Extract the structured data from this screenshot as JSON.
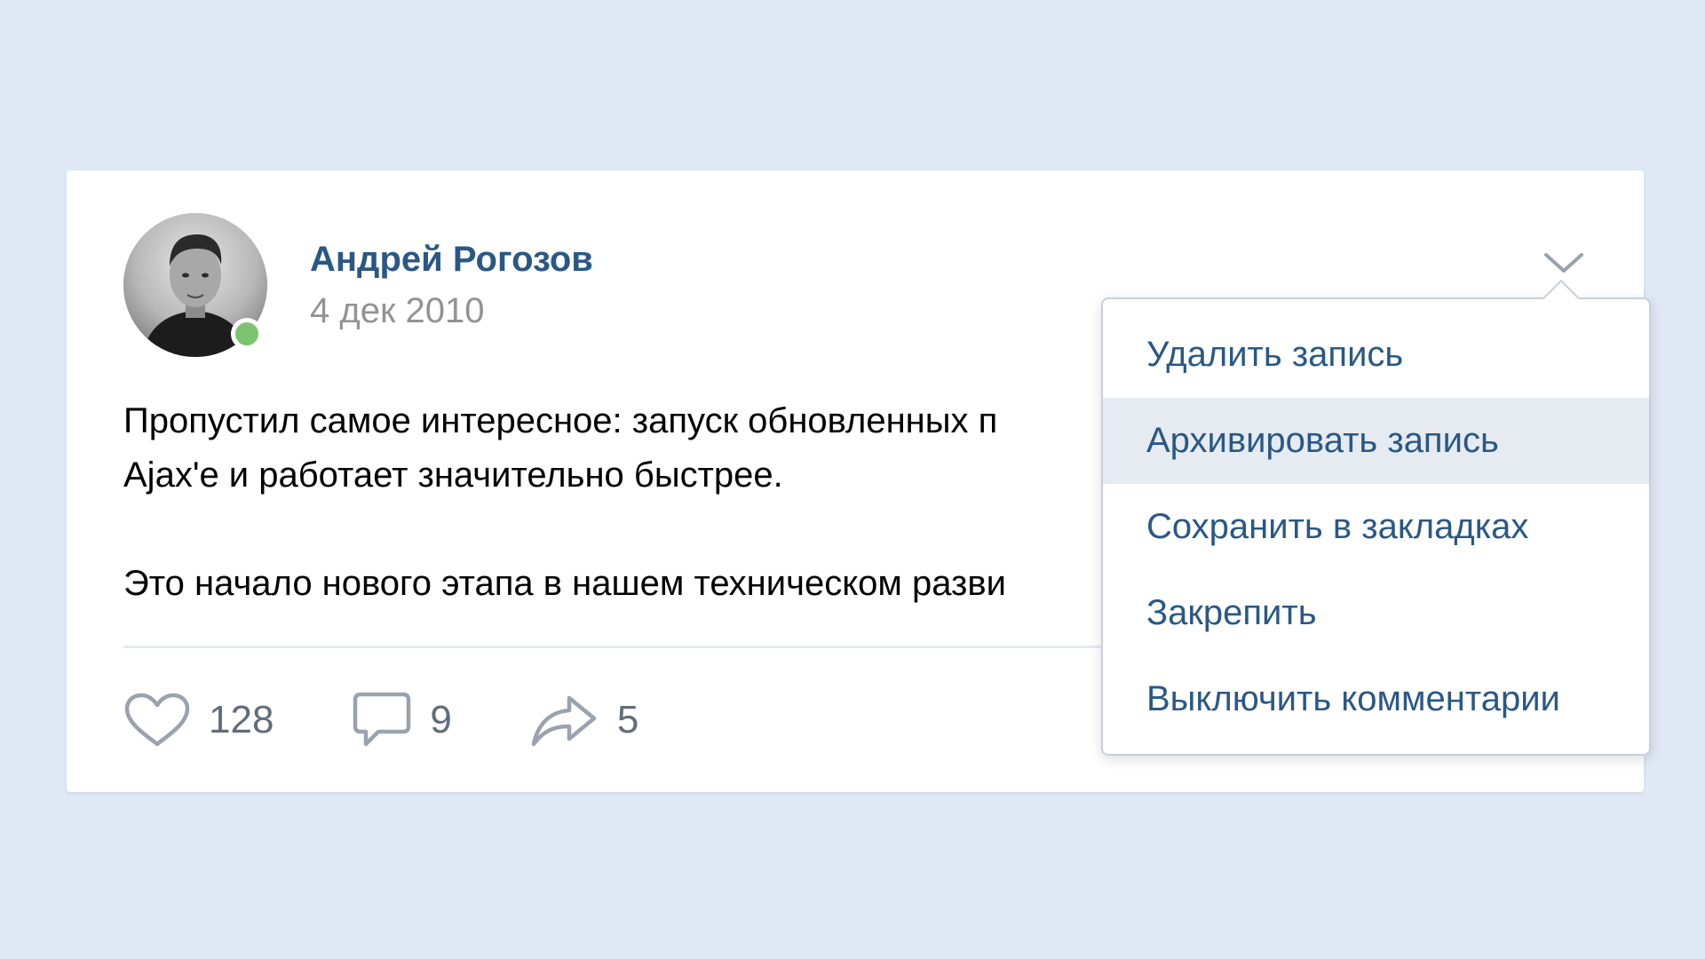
{
  "post": {
    "author": "Андрей Рогозов",
    "date": "4 дек 2010",
    "online": true,
    "text_lines": [
      "Пропустил самое интересное: запуск обновленных п",
      "Ajax'e и работает значительно быстрее.",
      "Это начало нового этапа в нашем техническом разви"
    ],
    "likes": "128",
    "comments": "9",
    "shares": "5"
  },
  "icons": {
    "like": "heart-icon",
    "comment": "comment-icon",
    "share": "share-icon",
    "menu": "chevron-down-icon"
  },
  "menu": {
    "items": [
      "Удалить запись",
      "Архивировать запись",
      "Сохранить в закладках",
      "Закрепить",
      "Выключить комментарии"
    ],
    "hovered_index": 1
  },
  "colors": {
    "background": "#dfe8f4",
    "link": "#2a5885",
    "muted": "#939393",
    "online": "#7cc46f",
    "hover": "#e5ebf1"
  }
}
